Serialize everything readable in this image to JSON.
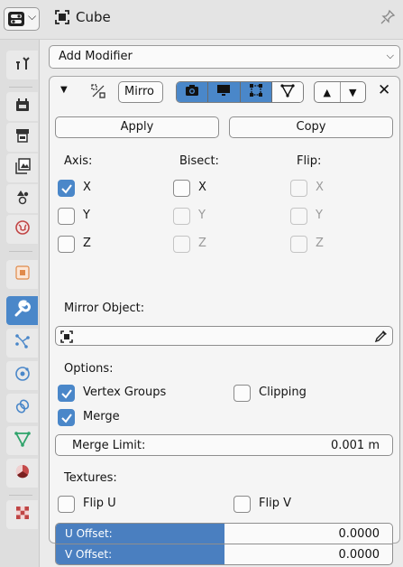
{
  "header": {
    "object_name": "Cube",
    "editor_type_icon": "properties-editor-icon",
    "pin_icon": "pin-icon"
  },
  "tabs": [
    {
      "name": "tool",
      "icon": "tool-icon",
      "active": false
    },
    {
      "name": "render",
      "icon": "render-icon",
      "active": false
    },
    {
      "name": "output",
      "icon": "output-icon",
      "active": false
    },
    {
      "name": "view-layer",
      "icon": "view-layer-icon",
      "active": false
    },
    {
      "name": "scene",
      "icon": "scene-icon",
      "active": false
    },
    {
      "name": "world",
      "icon": "world-icon",
      "active": false
    },
    {
      "name": "object",
      "icon": "object-icon",
      "active": false
    },
    {
      "name": "modifiers",
      "icon": "wrench-icon",
      "active": true
    },
    {
      "name": "particles",
      "icon": "particles-icon",
      "active": false
    },
    {
      "name": "physics",
      "icon": "physics-icon",
      "active": false
    },
    {
      "name": "constraints",
      "icon": "constraints-icon",
      "active": false
    },
    {
      "name": "data",
      "icon": "mesh-data-icon",
      "active": false
    },
    {
      "name": "material",
      "icon": "material-icon",
      "active": false
    },
    {
      "name": "texture",
      "icon": "texture-icon",
      "active": false
    }
  ],
  "modifiers": {
    "add_modifier_label": "Add Modifier",
    "mirror": {
      "name": "Mirro",
      "apply_label": "Apply",
      "copy_label": "Copy",
      "axis_label": "Axis:",
      "bisect_label": "Bisect:",
      "flip_label": "Flip:",
      "axis": {
        "x": {
          "label": "X",
          "checked": true
        },
        "y": {
          "label": "Y",
          "checked": false
        },
        "z": {
          "label": "Z",
          "checked": false
        }
      },
      "bisect": {
        "x": {
          "label": "X",
          "checked": false
        },
        "y": {
          "label": "Y",
          "checked": false
        },
        "z": {
          "label": "Z",
          "checked": false
        }
      },
      "flip": {
        "x": {
          "label": "X",
          "checked": false
        },
        "y": {
          "label": "Y",
          "checked": false
        },
        "z": {
          "label": "Z",
          "checked": false
        }
      },
      "mirror_object_label": "Mirror Object:",
      "options_label": "Options:",
      "vertex_groups": {
        "label": "Vertex Groups",
        "checked": true
      },
      "clipping": {
        "label": "Clipping",
        "checked": false
      },
      "merge": {
        "label": "Merge",
        "checked": true
      },
      "merge_limit": {
        "label": "Merge Limit:",
        "value": "0.001 m"
      },
      "textures_label": "Textures:",
      "flip_u": {
        "label": "Flip U",
        "checked": false
      },
      "flip_v": {
        "label": "Flip V",
        "checked": false
      },
      "u_offset": {
        "label": "U Offset:",
        "value": "0.0000",
        "fill_fraction": 0.5
      },
      "v_offset": {
        "label": "V Offset:",
        "value": "0.0000",
        "fill_fraction": 0.5
      }
    }
  },
  "colors": {
    "accent": "#4a87c9",
    "slider_fill": "#4a7fc0"
  }
}
